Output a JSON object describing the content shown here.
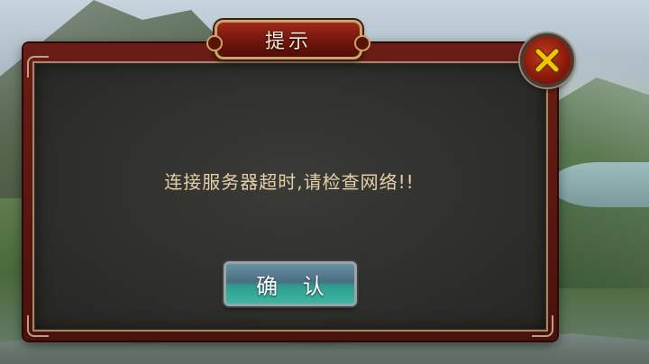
{
  "dialog": {
    "title": "提示",
    "message": "连接服务器超时,请检查网络!!",
    "confirm_label": "确 认",
    "close_icon": "close-x-icon"
  },
  "colors": {
    "frame": "#6a1d14",
    "panel": "#2e2f2b",
    "message_text": "#e5cfa9",
    "close_x": "#f5c400",
    "confirm_button": "#3cb7a3"
  }
}
